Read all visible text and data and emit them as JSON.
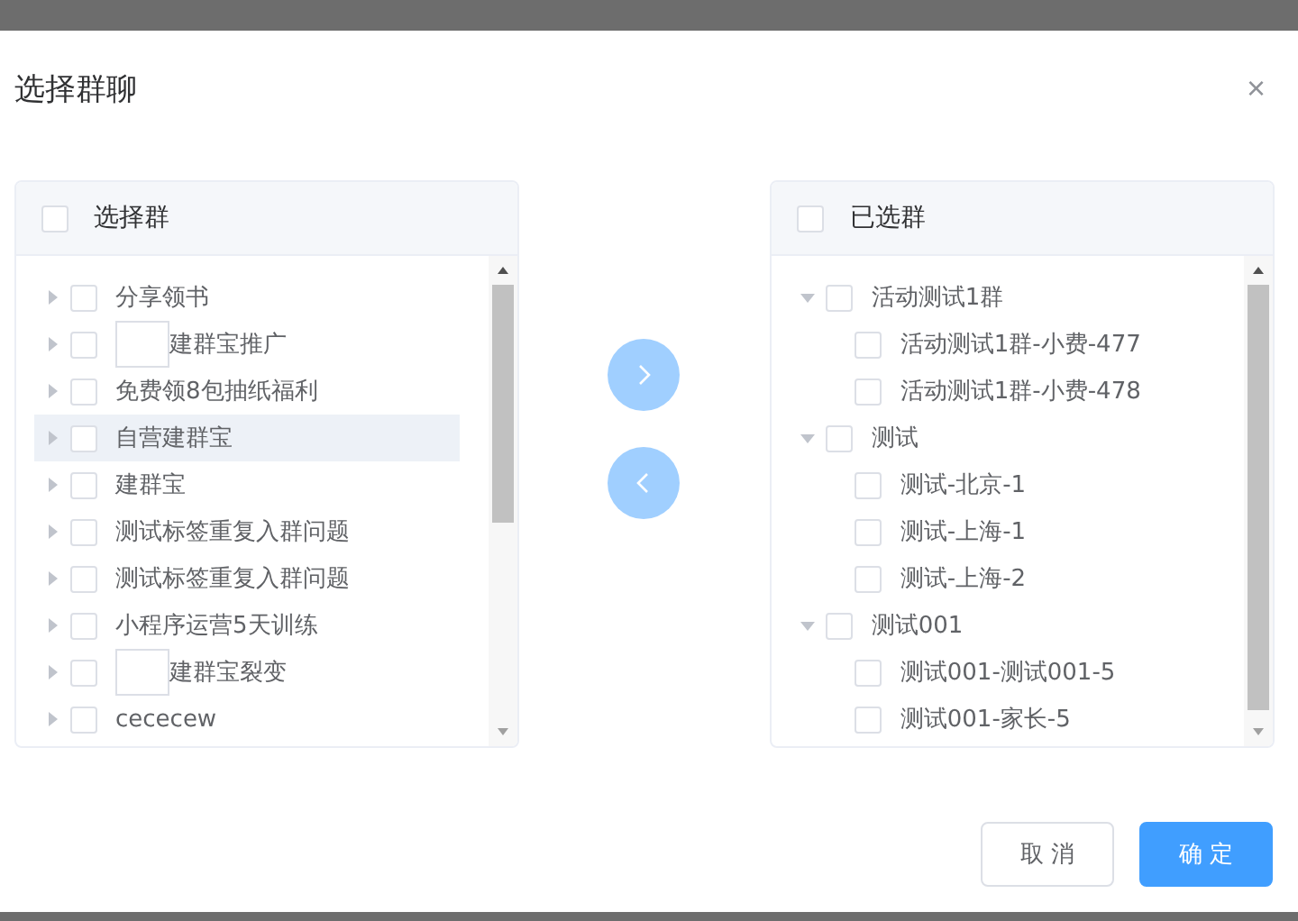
{
  "dialog": {
    "title": "选择群聊",
    "close": "×"
  },
  "source": {
    "title": "选择群",
    "checked": false,
    "items": [
      {
        "label": "分享领书",
        "checked": false,
        "expanded": false,
        "highlighted": false,
        "blank_image": false
      },
      {
        "label": "建群宝推广",
        "checked": false,
        "expanded": false,
        "highlighted": false,
        "blank_image": true
      },
      {
        "label": "免费领8包抽纸福利",
        "checked": false,
        "expanded": false,
        "highlighted": false,
        "blank_image": false
      },
      {
        "label": "自营建群宝",
        "checked": false,
        "expanded": false,
        "highlighted": true,
        "blank_image": false
      },
      {
        "label": "建群宝",
        "checked": false,
        "expanded": false,
        "highlighted": false,
        "blank_image": false
      },
      {
        "label": "测试标签重复入群问题",
        "checked": false,
        "expanded": false,
        "highlighted": false,
        "blank_image": false
      },
      {
        "label": "测试标签重复入群问题",
        "checked": false,
        "expanded": false,
        "highlighted": false,
        "blank_image": false
      },
      {
        "label": "小程序运营5天训练",
        "checked": false,
        "expanded": false,
        "highlighted": false,
        "blank_image": false
      },
      {
        "label": "建群宝裂变",
        "checked": false,
        "expanded": false,
        "highlighted": false,
        "blank_image": true
      },
      {
        "label": "cececew",
        "checked": false,
        "expanded": false,
        "highlighted": false,
        "blank_image": false
      }
    ]
  },
  "target": {
    "title": "已选群",
    "checked": false,
    "items": [
      {
        "label": "活动测试1群",
        "checked": false,
        "expanded": true,
        "children": [
          {
            "label": "活动测试1群-小费-477",
            "checked": false
          },
          {
            "label": "活动测试1群-小费-478",
            "checked": false
          }
        ]
      },
      {
        "label": "测试",
        "checked": false,
        "expanded": true,
        "children": [
          {
            "label": "测试-北京-1",
            "checked": false
          },
          {
            "label": "测试-上海-1",
            "checked": false
          },
          {
            "label": "测试-上海-2",
            "checked": false
          }
        ]
      },
      {
        "label": "测试001",
        "checked": false,
        "expanded": true,
        "children": [
          {
            "label": "测试001-测试001-5",
            "checked": false
          },
          {
            "label": "测试001-家长-5",
            "checked": false
          }
        ]
      }
    ]
  },
  "buttons": [
    {
      "label": "取 消",
      "kind": "default"
    },
    {
      "label": "确 定",
      "kind": "primary"
    }
  ]
}
